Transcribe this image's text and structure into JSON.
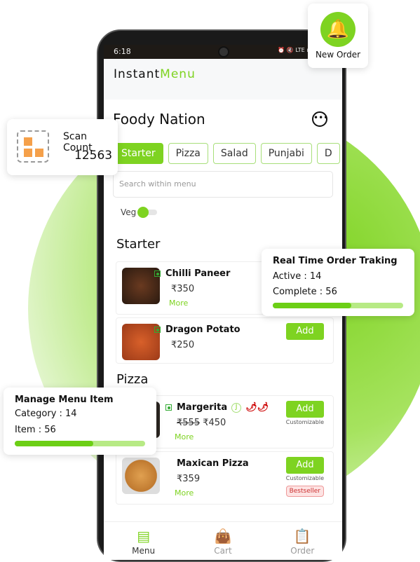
{
  "colors": {
    "accent": "#7ed321",
    "bestseller": "#cc3333"
  },
  "status": {
    "time": "6:18",
    "icons": "⏰ 🔇 LTE ıll LTE2 ıll"
  },
  "brand": {
    "part1": "Instant",
    "part2": "Menu"
  },
  "restaurant": "Foody Nation",
  "more_icon": "more-horizontal-icon",
  "categories": [
    "Starter",
    "Pizza",
    "Salad",
    "Punjabi",
    "D"
  ],
  "search": {
    "placeholder": "Search within menu"
  },
  "veg_label": "Veg",
  "sections": [
    {
      "title": "Starter",
      "items": [
        {
          "name": "Chilli Paneer",
          "price": "₹350",
          "more": "More"
        },
        {
          "name": "Dragon Potato",
          "price": "₹250",
          "add": "Add"
        }
      ]
    },
    {
      "title": "Pizza",
      "items": [
        {
          "name": "Margerita",
          "old_price": "₹555",
          "price": "₹450",
          "more": "More",
          "add": "Add",
          "note": "Customizable",
          "badge": "J"
        },
        {
          "name": "Maxican Pizza",
          "price": "₹359",
          "more": "More",
          "add": "Add",
          "note": "Customizable",
          "tag": "Bestseller"
        }
      ]
    }
  ],
  "nav": [
    {
      "label": "Menu",
      "icon": "menu-book-icon"
    },
    {
      "label": "Cart",
      "icon": "shopping-bag-icon"
    },
    {
      "label": "Order",
      "icon": "clipboard-icon"
    }
  ],
  "new_order": {
    "label": "New Order",
    "icon": "bell-icon"
  },
  "scan": {
    "label": "Scan Count",
    "value": "12563",
    "icon": "qr-code-icon"
  },
  "tracking": {
    "title": "Real Time Order Traking",
    "active": "Active : 14",
    "complete": "Complete : 56",
    "progress": 0.6
  },
  "manage": {
    "title": "Manage Menu Item",
    "category": "Category : 14",
    "item": "Item : 56",
    "progress": 0.6
  }
}
